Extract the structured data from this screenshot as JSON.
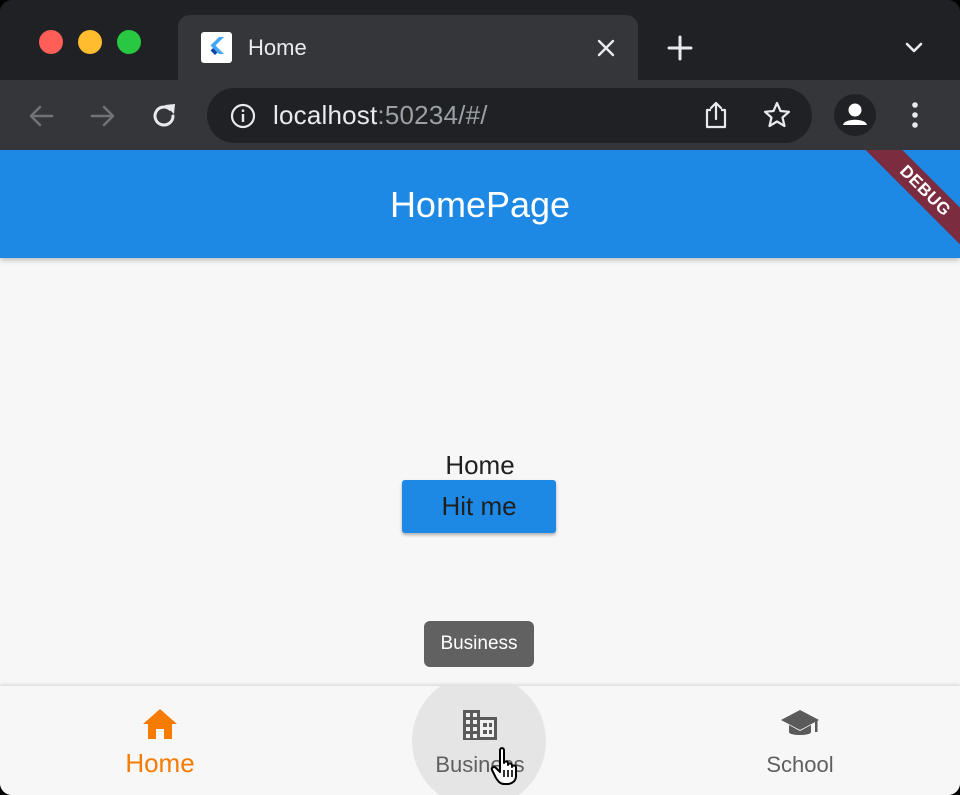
{
  "browser": {
    "tab_title": "Home",
    "url_host": "localhost",
    "url_rest": ":50234/#/"
  },
  "app": {
    "appbar_title": "HomePage",
    "debug_banner": "DEBUG",
    "body_label": "Home",
    "button_label": "Hit me",
    "tooltip": "Business",
    "colors": {
      "primary": "#1e88e5",
      "selected": "#f57c00",
      "unselected": "#5f5f5f"
    }
  },
  "bottom_nav": {
    "items": [
      {
        "label": "Home",
        "icon": "home-icon",
        "selected": true
      },
      {
        "label": "Business",
        "icon": "business-icon",
        "selected": false
      },
      {
        "label": "School",
        "icon": "school-icon",
        "selected": false
      }
    ]
  }
}
